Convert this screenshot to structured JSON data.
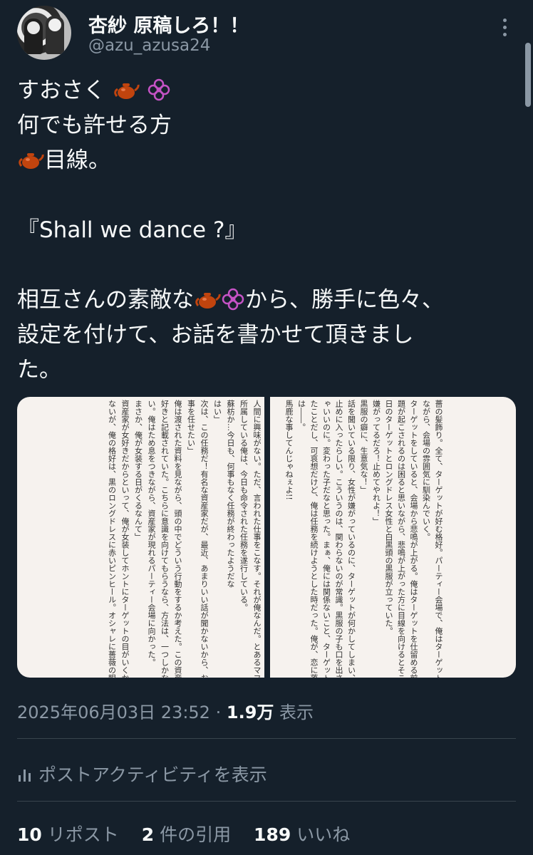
{
  "author": {
    "display_name": "杏紗 原稿しろ！！",
    "handle": "@azu_azusa24",
    "avatar_icon": "avatar-image",
    "more_icon": "more-options-icon"
  },
  "tweet": {
    "lines": [
      {
        "text_a": "すおさく",
        "emoji": [
          "teapot",
          "flower"
        ]
      },
      {
        "text_a": "何でも許せる方"
      },
      {
        "emoji_lead": "teapot",
        "text_b": "目線。"
      },
      {
        "text_a": "『Shall we dance ?』"
      },
      {
        "text_a": "相互さんの素敵な",
        "text_b": "から、勝手に色々、"
      },
      {
        "text_a": "設定を付けて、お話を書かせて頂きまし"
      },
      {
        "text_a": "た。"
      }
    ],
    "colors": {
      "teapot": "#c1440e",
      "flower": "#c653c6"
    }
  },
  "media": {
    "left_page_columns": [
      "人間に興味がない。ただ、言われた仕事をこなす。それが俺なんだ。とあるマフィア",
      "所属している俺は、今日も命令された任務を遂行している。",
      "蘇枋か…今日も、何事もなく任務が終わったようだな",
      "はい」",
      "次は、この任務だ！有名な資産家だが、最近、あまりいい話が聞かないから、お前に",
      "事を任せたい」",
      "俺は渡された資料を見ながら、頭の中でどういう行動をするか考えた。この資産家は、",
      "好きと記載されていた。こちらに意識を向けてもらうなら、方法は、一つしかないと",
      "い。俺はため息をつきながら、資産家が現れるパーティー会場に向かった。",
      "まさか、俺が女装する日がくるなんて」",
      "資産家が女好きだからといって、俺が女装してホントにターゲットの目がいくか分か",
      "ないが、俺の格好は、黒のロングドレスに赤いピンヒール。オシャレに薔薇の眼帯と"
    ],
    "right_page_columns": [
      "薔の髪飾り。全て、ターゲットが好む格好。パーティー会場で、俺はターゲットを探",
      "ながら、会場の雰囲気に馴染んでいく。",
      "ターゲットをしていると、会場から悲鳴が上がる。俺はターゲットを仕留める前に",
      "題が起こされるのは困ると思いながら、悲鳴が上がった方に目線を向けるとそこには、",
      "日のターゲットとロングドレス女性と白黒頭の黒服が立っていた。",
      "嫌がってるだろ！止めてやれよ！」",
      "黒服の癖に、生意気な！」",
      "話を聞いている限り、女性が嫌がっているのに、ターゲットが何かしてしまい、黒服",
      "止めに入ったらしい。こういうのは、関わらないのが常識。黒服の子も口を出さな",
      "ゃいいのに。変わった子だなと思った。まぁ、俺には関係ないこと、ターゲットも見つ",
      "たことだし、可哀想だけど、俺は任務を続けようとした時だった。俺が、恋に落ちた",
      "は――。",
      "馬鹿な事してんじゃねぇよ!!"
    ]
  },
  "meta": {
    "timestamp": "2025年06月03日 23:52",
    "separator": "·",
    "views_count": "1.9万",
    "views_label": "表示"
  },
  "activity": {
    "label": "ポストアクティビティを表示",
    "icon": "analytics-bar-icon"
  },
  "stats": {
    "reposts_count": "10",
    "reposts_label": "リポスト",
    "quotes_count": "2",
    "quotes_label": "件の引用",
    "likes_count": "189",
    "likes_label": "いいね"
  }
}
